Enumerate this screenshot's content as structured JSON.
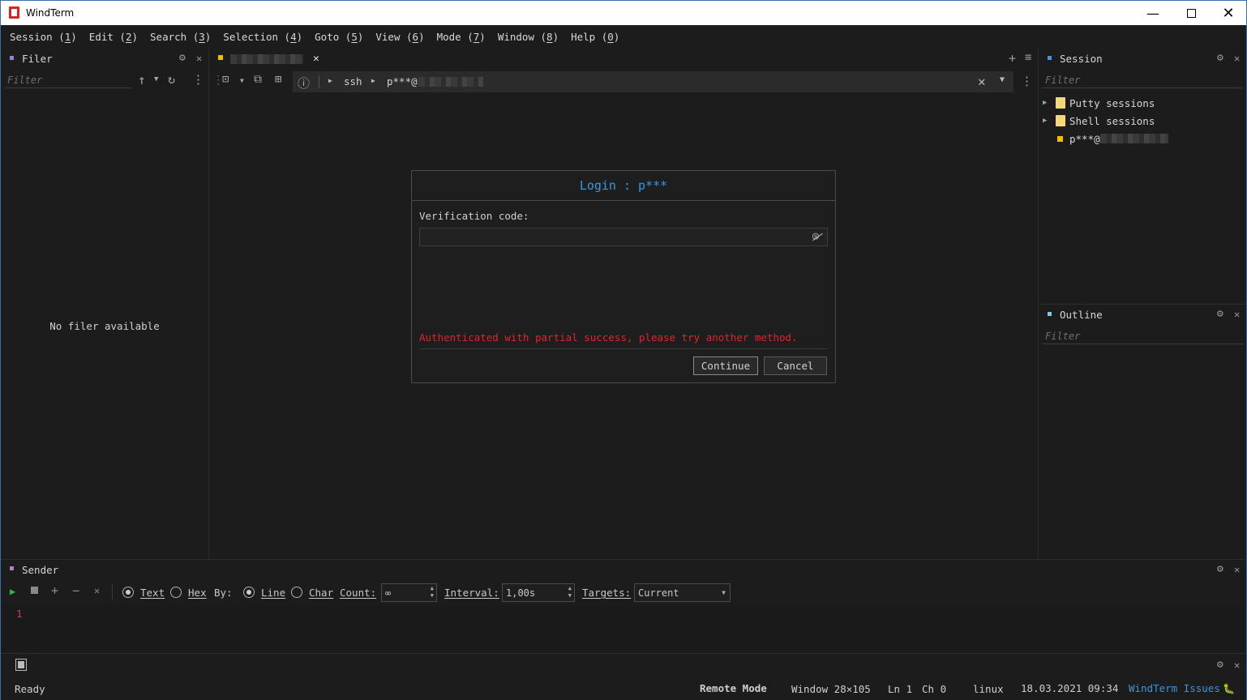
{
  "window": {
    "title": "WindTerm"
  },
  "menu": [
    {
      "pre": "Session (",
      "key": "1",
      "post": ")"
    },
    {
      "pre": "Edit (",
      "key": "2",
      "post": ")"
    },
    {
      "pre": "Search (",
      "key": "3",
      "post": ")"
    },
    {
      "pre": "Selection (",
      "key": "4",
      "post": ")"
    },
    {
      "pre": "Goto (",
      "key": "5",
      "post": ")"
    },
    {
      "pre": "View (",
      "key": "6",
      "post": ")"
    },
    {
      "pre": "Mode (",
      "key": "7",
      "post": ")"
    },
    {
      "pre": "Window (",
      "key": "8",
      "post": ")"
    },
    {
      "pre": "Help (",
      "key": "0",
      "post": ")"
    }
  ],
  "filer": {
    "title": "Filer",
    "filter_placeholder": "Filter",
    "empty_text": "No filer available"
  },
  "terminal": {
    "breadcrumb_protocol": "ssh",
    "breadcrumb_host": "p***@"
  },
  "dialog": {
    "title": "Login : p***",
    "field_label": "Verification code:",
    "error": "Authenticated with partial success, please try another method.",
    "continue_label": "Continue",
    "cancel_label": "Cancel"
  },
  "session": {
    "title": "Session",
    "filter_placeholder": "Filter",
    "items": [
      {
        "label": "Putty sessions"
      },
      {
        "label": "Shell sessions"
      },
      {
        "label": "p***@"
      }
    ]
  },
  "outline": {
    "title": "Outline",
    "filter_placeholder": "Filter"
  },
  "sender": {
    "title": "Sender",
    "text_label": "Text",
    "hex_label": "Hex",
    "by_label": "By:",
    "line_label": "Line",
    "char_label": "Char",
    "count_label": "Count:",
    "count_value": "∞",
    "interval_label": "Interval:",
    "interval_value": "1,00s",
    "targets_label": "Targets:",
    "targets_value": "Current",
    "line_number": "1"
  },
  "status": {
    "ready": "Ready",
    "mode": "Remote Mode",
    "window_size": "Window 28×105",
    "ln": "Ln 1",
    "ch": "Ch 0",
    "os": "linux",
    "datetime": "18.03.2021 09:34",
    "issues": "WindTerm Issues"
  },
  "colors": {
    "accent_blue": "#3a97e0",
    "error_red": "#e0242a",
    "tab_yellow": "#f0c000",
    "folder": "#f3d77c"
  }
}
